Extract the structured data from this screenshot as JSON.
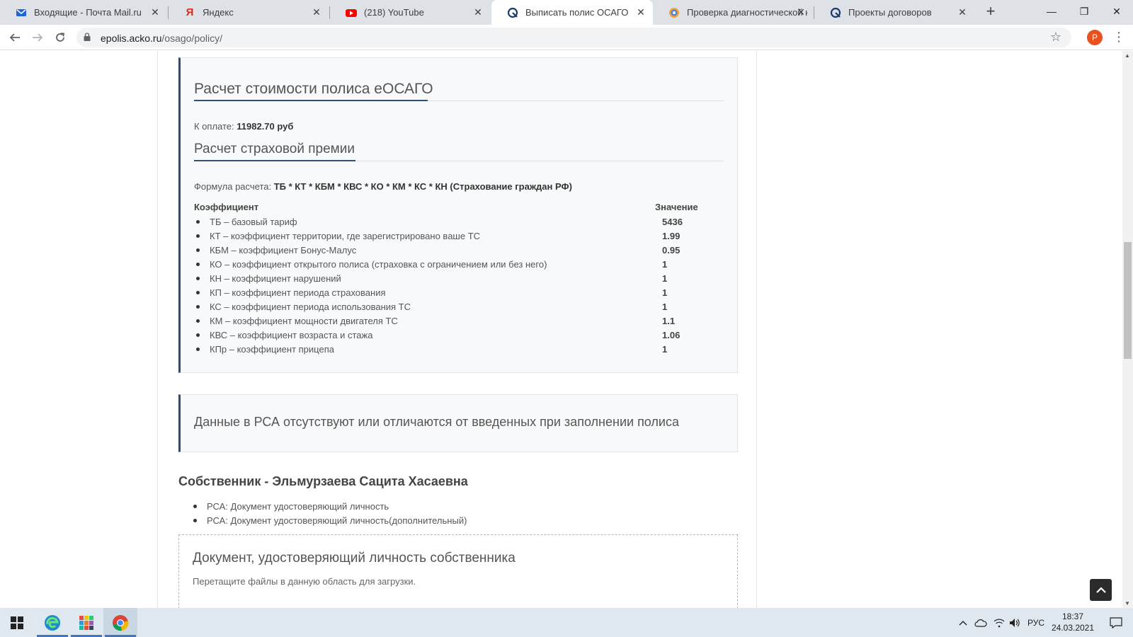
{
  "browser": {
    "tabs": [
      {
        "title": "Входящие - Почта Mail.ru",
        "icon": "mail-icon"
      },
      {
        "title": "Яндекс",
        "icon": "yandex-icon"
      },
      {
        "title": "(218) YouTube",
        "icon": "youtube-icon"
      },
      {
        "title": "Выписать полис ОСАГО",
        "icon": "acko-icon"
      },
      {
        "title": "Проверка диагностической к",
        "icon": "diag-icon"
      },
      {
        "title": "Проекты договоров",
        "icon": "acko-icon"
      }
    ],
    "active_tab": 3,
    "url_host": "epolis.acko.ru",
    "url_path": "/osago/policy/",
    "profile_initial": "P"
  },
  "calc": {
    "title": "Расчет стоимости полиса еОСАГО",
    "pay_label": "К оплате:",
    "pay_value": "11982.70 руб",
    "premium_title": "Расчет страховой премии",
    "formula_label": "Формула расчета:",
    "formula_value": "ТБ * КТ * КБМ * КВС * КО * КМ * КС * КН (Страхование граждан РФ)",
    "col_coef": "Коэффициент",
    "col_value": "Значение",
    "rows": [
      {
        "label": "ТБ – базовый тариф",
        "value": "5436"
      },
      {
        "label": "КТ – коэффициент территории, где зарегистрировано ваше ТС",
        "value": "1.99"
      },
      {
        "label": "КБМ – коэффициент Бонус-Малус",
        "value": "0.95"
      },
      {
        "label": "КО – коэффициент открытого полиса (страховка с ограничением или без него)",
        "value": "1"
      },
      {
        "label": "КН – коэффициент нарушений",
        "value": "1"
      },
      {
        "label": "КП – коэффициент периода страхования",
        "value": "1"
      },
      {
        "label": "КС – коэффициент периода использования ТС",
        "value": "1"
      },
      {
        "label": "КМ – коэффициент мощности двигателя ТС",
        "value": "1.1"
      },
      {
        "label": "КВС – коэффициент возраста и стажа",
        "value": "1.06"
      },
      {
        "label": "КПр – коэффициент прицепа",
        "value": "1"
      }
    ]
  },
  "notice": {
    "text": "Данные в РСА отсутствуют или отличаются от введенных при заполнении полиса"
  },
  "owner": {
    "title": "Собственник - Эльмурзаева Сацита Хасаевна",
    "docs": [
      "РСА: Документ удостоверяющий личность",
      "РСА: Документ удостоверяющий личность(дополнительный)"
    ]
  },
  "dropzone": {
    "title": "Документ, удостоверяющий личность собственника",
    "hint": "Перетащите файлы в данную область для загрузки."
  },
  "taskbar": {
    "lang": "РУС",
    "time": "18:37",
    "date": "24.03.2021"
  }
}
